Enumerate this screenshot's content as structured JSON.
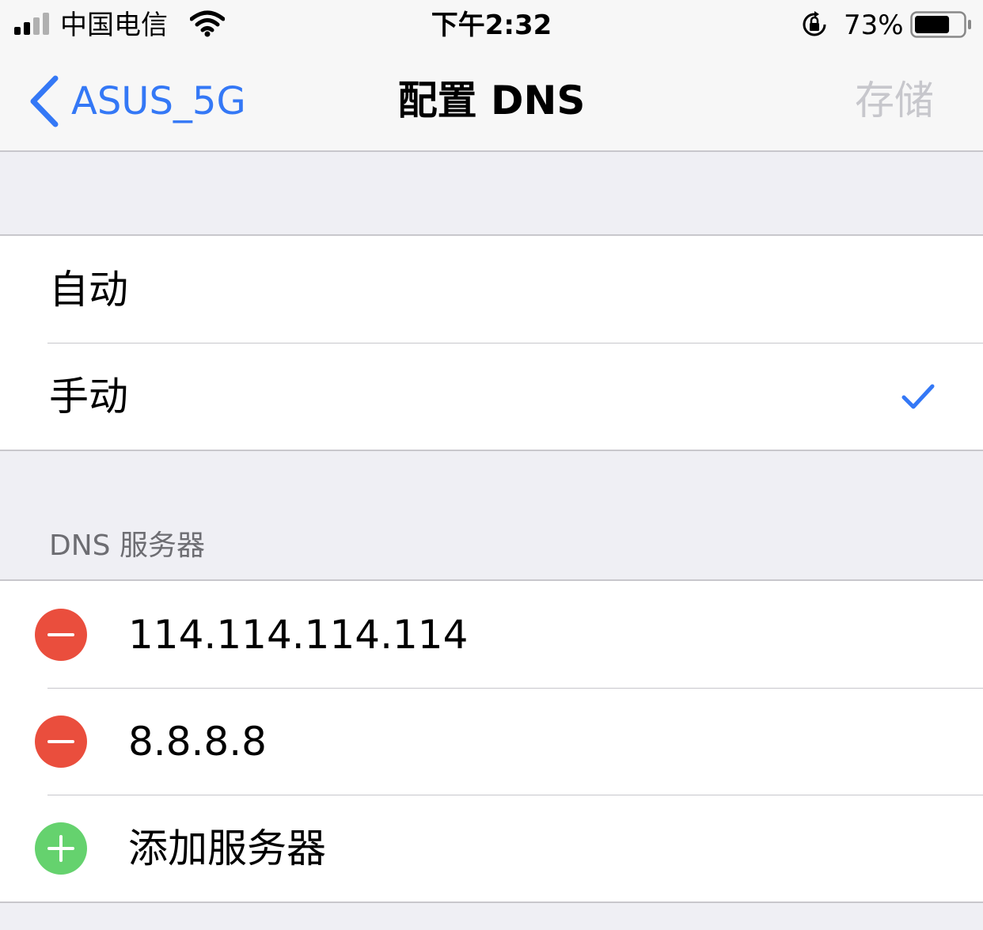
{
  "status_bar": {
    "carrier": "中国电信",
    "time": "下午2:32",
    "battery_percent": "73%",
    "battery_level": 0.73
  },
  "nav": {
    "back_label": "ASUS_5G",
    "title": "配置 DNS",
    "save_label": "存储"
  },
  "mode": {
    "options": [
      {
        "label": "自动",
        "selected": false
      },
      {
        "label": "手动",
        "selected": true
      }
    ]
  },
  "dns_section": {
    "header": "DNS 服务器",
    "servers": [
      "114.114.114.114",
      "8.8.8.8"
    ],
    "add_label": "添加服务器"
  },
  "colors": {
    "accent": "#3478f6",
    "remove": "#ea4e3d",
    "add": "#65d26e",
    "disabled": "#c7c7cc"
  }
}
